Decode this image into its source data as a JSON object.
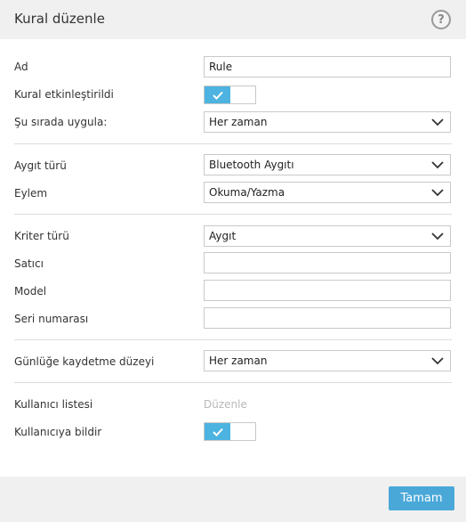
{
  "dialog": {
    "title": "Kural düzenle",
    "help": "?"
  },
  "form": {
    "name": {
      "label": "Ad",
      "value": "Rule"
    },
    "rule_enabled": {
      "label": "Kural etkinleştirildi",
      "on": true
    },
    "apply_when": {
      "label": "Şu sırada uygula:",
      "value": "Her zaman"
    },
    "device_type": {
      "label": "Aygıt türü",
      "value": "Bluetooth Aygıtı"
    },
    "action": {
      "label": "Eylem",
      "value": "Okuma/Yazma"
    },
    "criteria_type": {
      "label": "Kriter türü",
      "value": "Aygıt"
    },
    "vendor": {
      "label": "Satıcı",
      "value": ""
    },
    "model": {
      "label": "Model",
      "value": ""
    },
    "serial": {
      "label": "Seri numarası",
      "value": ""
    },
    "log_level": {
      "label": "Günlüğe kaydetme düzeyi",
      "value": "Her zaman"
    },
    "user_list": {
      "label": "Kullanıcı listesi",
      "link": "Düzenle"
    },
    "notify_user": {
      "label": "Kullanıcıya bildir",
      "on": true
    }
  },
  "footer": {
    "ok_label": "Tamam"
  },
  "colors": {
    "accent": "#4db3e0",
    "button": "#4aa8d8",
    "header_bg": "#f0f0f0",
    "disabled_text": "#b9b9b9"
  },
  "icons": {
    "help": "question-circle-icon",
    "toggle_check": "check-icon",
    "dropdown": "chevron-down-icon"
  }
}
